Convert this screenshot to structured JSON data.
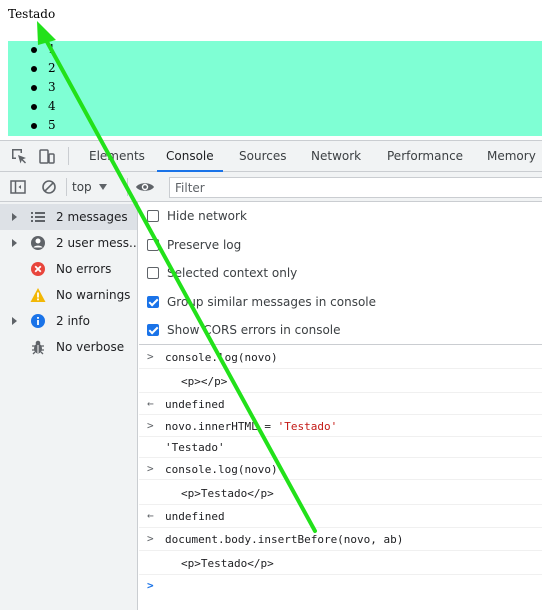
{
  "page": {
    "heading": "Testado",
    "list_items": [
      "1",
      "2",
      "3",
      "4",
      "5"
    ],
    "list_background": "#7fffd4"
  },
  "devtools": {
    "icons": {
      "inspect": "inspect-element-icon",
      "device": "device-toolbar-icon",
      "sidebar": "show-sidebar-icon",
      "clear": "clear-console-icon",
      "eye": "live-expression-eye-icon"
    },
    "tabs": [
      "Elements",
      "Console",
      "Sources",
      "Network",
      "Performance",
      "Memory"
    ],
    "active_tab": "Console",
    "toolbar": {
      "context": "top",
      "filter_placeholder": "Filter"
    },
    "sidebar": {
      "items": [
        {
          "label": "2 messages",
          "icon": "list-icon",
          "expandable": true,
          "selected": true
        },
        {
          "label": "2 user mess...",
          "icon": "user-icon",
          "expandable": true,
          "selected": false
        },
        {
          "label": "No errors",
          "icon": "error-icon",
          "expandable": false,
          "selected": false
        },
        {
          "label": "No warnings",
          "icon": "warning-icon",
          "expandable": false,
          "selected": false
        },
        {
          "label": "2 info",
          "icon": "info-icon",
          "expandable": true,
          "selected": false
        },
        {
          "label": "No verbose",
          "icon": "bug-icon",
          "expandable": false,
          "selected": false
        }
      ]
    },
    "settings": [
      {
        "label": "Hide network",
        "checked": false
      },
      {
        "label": "Preserve log",
        "checked": false
      },
      {
        "label": "Selected context only",
        "checked": false
      },
      {
        "label": "Group similar messages in console",
        "checked": true
      },
      {
        "label": "Show CORS errors in console",
        "checked": true
      }
    ],
    "console": {
      "line1_input": "console.log(novo)",
      "line1_output": "<p></p>",
      "line1_result": "undefined",
      "line2_input_code": "novo.innerHTML = ",
      "line2_input_str": "'Testado'",
      "line2_result": "'Testado'",
      "line3_input": "console.log(novo)",
      "line3_output": "<p>Testado</p>",
      "line3_result": "undefined",
      "line4_input": "document.body.insertBefore(novo, ab)",
      "line4_output": "<p>Testado</p>",
      "prompt_symbol": ">",
      "result_symbol": "←"
    }
  },
  "annotation": {
    "arrow_color": "#22e11a",
    "arrow_icon": "green-arrow"
  }
}
